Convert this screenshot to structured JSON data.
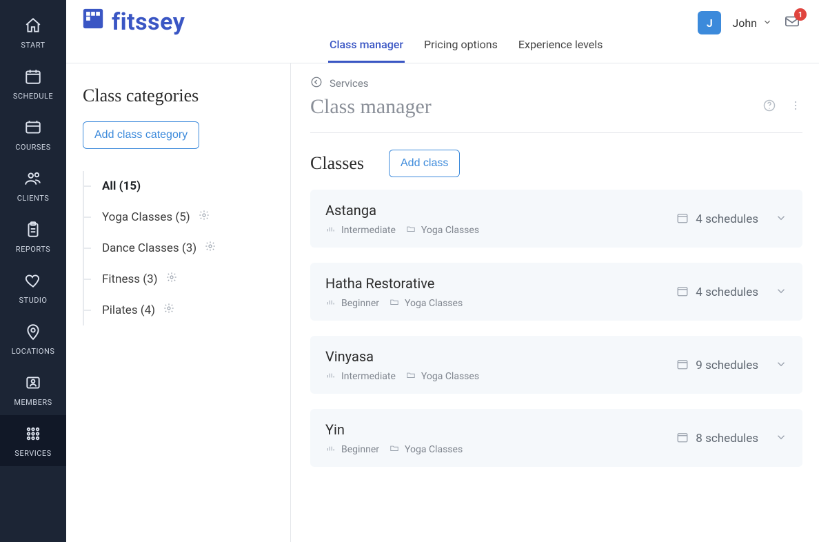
{
  "brand": {
    "name": "fitssey"
  },
  "user": {
    "initial": "J",
    "name": "John",
    "notifications": "1"
  },
  "nav": [
    {
      "label": "START"
    },
    {
      "label": "SCHEDULE"
    },
    {
      "label": "COURSES"
    },
    {
      "label": "CLIENTS"
    },
    {
      "label": "REPORTS"
    },
    {
      "label": "STUDIO"
    },
    {
      "label": "LOCATIONS"
    },
    {
      "label": "MEMBERS"
    },
    {
      "label": "SERVICES"
    }
  ],
  "tabs": [
    {
      "label": "Class manager",
      "active": true
    },
    {
      "label": "Pricing options"
    },
    {
      "label": "Experience levels"
    }
  ],
  "breadcrumb": {
    "back": "Services"
  },
  "page": {
    "title": "Class manager"
  },
  "categoriesPanel": {
    "heading": "Class categories",
    "addLabel": "Add class category",
    "items": [
      {
        "label": "All (15)",
        "active": true
      },
      {
        "label": "Yoga Classes (5)"
      },
      {
        "label": "Dance Classes (3)"
      },
      {
        "label": "Fitness (3)"
      },
      {
        "label": "Pilates (4)"
      }
    ]
  },
  "classesSection": {
    "heading": "Classes",
    "addLabel": "Add class",
    "items": [
      {
        "name": "Astanga",
        "level": "Intermediate",
        "category": "Yoga Classes",
        "schedules": "4 schedules"
      },
      {
        "name": "Hatha Restorative",
        "level": "Beginner",
        "category": "Yoga Classes",
        "schedules": "4 schedules"
      },
      {
        "name": "Vinyasa",
        "level": "Intermediate",
        "category": "Yoga Classes",
        "schedules": "9 schedules"
      },
      {
        "name": "Yin",
        "level": "Beginner",
        "category": "Yoga Classes",
        "schedules": "8 schedules"
      }
    ]
  }
}
